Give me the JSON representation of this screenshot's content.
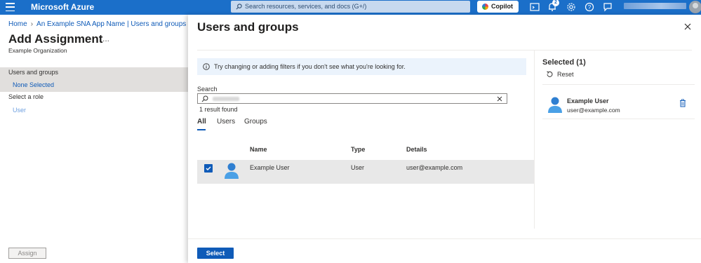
{
  "topbar": {
    "brand": "Microsoft Azure",
    "search_placeholder": "Search resources, services, and docs (G+/)",
    "copilot_label": "Copilot",
    "notification_count": "2",
    "icons": [
      "menu-icon",
      "search-icon",
      "cloud-shell-icon",
      "notifications-icon",
      "settings-icon",
      "help-icon",
      "feedback-icon",
      "account-avatar"
    ]
  },
  "breadcrumb": {
    "home": "Home",
    "app": "An Example SNA App Name | Users and groups"
  },
  "page": {
    "title": "Add Assignment",
    "more": "...",
    "org": "Example Organization",
    "users_groups_label": "Users and groups",
    "none_selected": "None Selected",
    "role_label": "Select a role",
    "role_value": "User",
    "assign_button": "Assign"
  },
  "panel": {
    "title": "Users and groups",
    "info_text": "Try changing or adding filters if you don't see what you're looking for.",
    "search_label": "Search",
    "result_count": "1 result found",
    "tabs": [
      "All",
      "Users",
      "Groups"
    ],
    "active_tab": "All",
    "columns": [
      "Name",
      "Type",
      "Details"
    ],
    "rows": [
      {
        "name": "Example User",
        "type": "User",
        "details": "user@example.com",
        "checked": true
      }
    ],
    "selected_title": "Selected (1)",
    "reset_label": "Reset",
    "selected_items": [
      {
        "name": "Example User",
        "email": "user@example.com"
      }
    ],
    "select_button": "Select"
  },
  "colors": {
    "topbar": "#1b6fc9",
    "link": "#0f5bb8",
    "primary_button": "#0f5bb8",
    "info_background": "#ebf3fc",
    "selected_row": "#e8e8e8"
  }
}
